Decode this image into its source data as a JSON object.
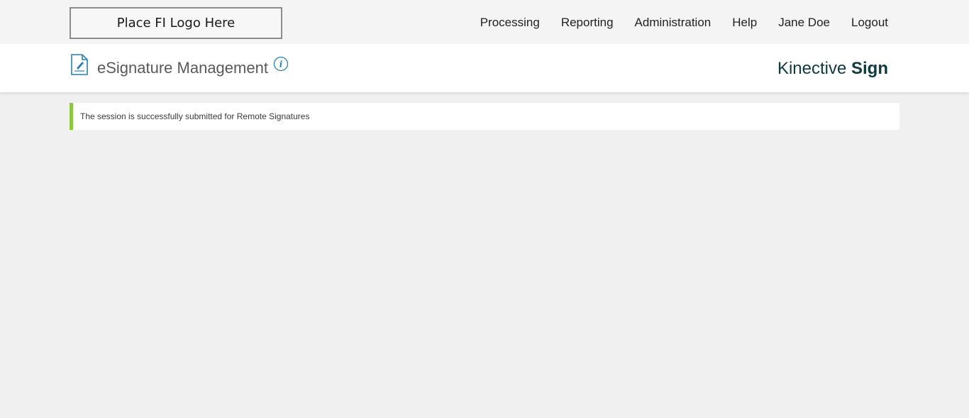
{
  "header": {
    "logo_text": "Place FI Logo Here",
    "nav": [
      {
        "label": "Processing"
      },
      {
        "label": "Reporting"
      },
      {
        "label": "Administration"
      },
      {
        "label": "Help"
      },
      {
        "label": "Jane Doe"
      },
      {
        "label": "Logout"
      }
    ]
  },
  "subheader": {
    "title": "eSignature Management",
    "doc_icon": "document-signature-icon",
    "info_icon": "info-icon",
    "brand_part1": "Kinective",
    "brand_part2": "Sign"
  },
  "alert": {
    "message": "The session is successfully submitted for Remote Signatures",
    "accent_color": "#8dc63f"
  },
  "colors": {
    "brand": "#0d3b40",
    "icon_blue": "#2a7fb0"
  }
}
